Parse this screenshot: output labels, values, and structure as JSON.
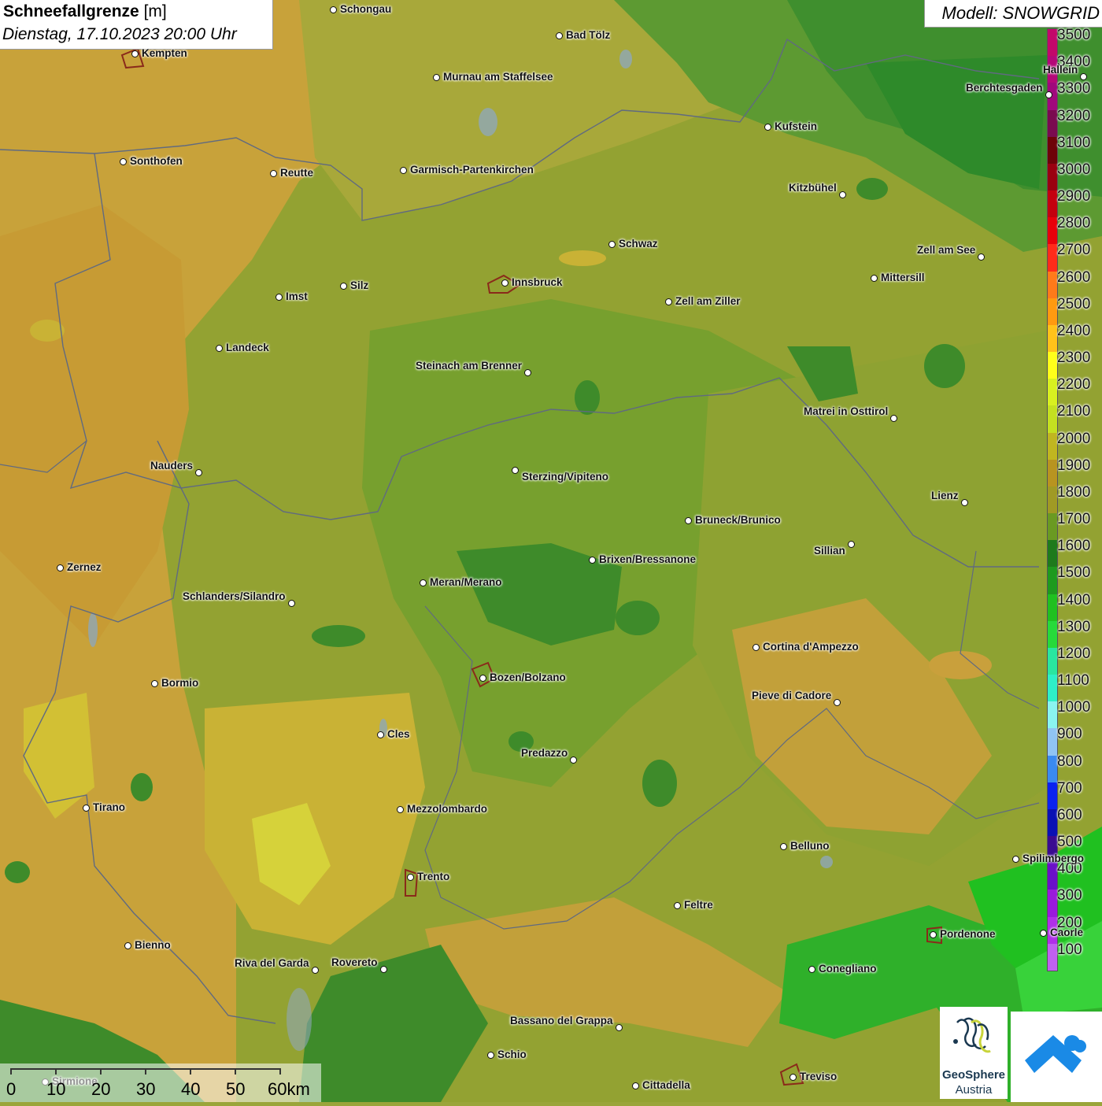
{
  "title": {
    "name": "Schneefallgrenze",
    "unit": "[m]",
    "datetime": "Dienstag, 17.10.2023 20:00 Uhr"
  },
  "model": "Modell: SNOWGRID",
  "legend": {
    "labels": [
      "3500",
      "3400",
      "3300",
      "3200",
      "3100",
      "3000",
      "2900",
      "2800",
      "2700",
      "2600",
      "2500",
      "2400",
      "2300",
      "2200",
      "2100",
      "2000",
      "1900",
      "1800",
      "1700",
      "1600",
      "1500",
      "1400",
      "1300",
      "1200",
      "1100",
      "1000",
      "900",
      "800",
      "700",
      "600",
      "500",
      "400",
      "300",
      "200",
      "100"
    ],
    "colors": [
      "#c2086a",
      "#b50878",
      "#a0087c",
      "#7a0a50",
      "#6e0208",
      "#9a0010",
      "#c4000e",
      "#e8000a",
      "#ff2a1a",
      "#ff7a1a",
      "#ff9a10",
      "#ffc21a",
      "#ffff1a",
      "#d8f020",
      "#c4e020",
      "#c0b620",
      "#b89420",
      "#a09a24",
      "#6a9a22",
      "#1e7a1c",
      "#1e9a1e",
      "#20c020",
      "#26da3a",
      "#2ae6a0",
      "#2ef0c8",
      "#8af4f0",
      "#90c4f4",
      "#3a8af0",
      "#0a22f0",
      "#0a10b4",
      "#3a0a90",
      "#6a10c8",
      "#9a1adc",
      "#b030e8",
      "#c060f0"
    ]
  },
  "cities": [
    "Schongau",
    "Bad Tölz",
    "Kempten",
    "Murnau am Staffelsee",
    "Kufstein",
    "Sonthofen",
    "Reutte",
    "Garmisch-Partenkirchen",
    "Kitzbühel",
    "Schwaz",
    "Zell am See",
    "Innsbruck",
    "Mittersill",
    "Imst",
    "Silz",
    "Zell am Ziller",
    "Landeck",
    "Steinach am Brenner",
    "Matrei in Osttirol",
    "Nauders",
    "Sterzing/Vipiteno",
    "Lienz",
    "Bruneck/Brunico",
    "Sillian",
    "Brixen/Bressanone",
    "Zernez",
    "Meran/Merano",
    "Schlanders/Silandro",
    "Cortina d'Ampezzo",
    "Bormio",
    "Bozen/Bolzano",
    "Pieve di Cadore",
    "Cles",
    "Predazzo",
    "Tirano",
    "Mezzolombardo",
    "Belluno",
    "Spilimbergo",
    "Trento",
    "Feltre",
    "Pordenone",
    "Bienno",
    "Riva del Garda",
    "Rovereto",
    "Conegliano",
    "Bassano del Grappa",
    "Schio",
    "Treviso",
    "Cittadella",
    "Berchtesgaden",
    "Hallein",
    "Caorle",
    "Sirmione"
  ],
  "scale": {
    "labels": [
      "0",
      "10",
      "20",
      "30",
      "40",
      "50",
      "60km"
    ]
  },
  "logos": {
    "geosphere_line1": "GeoSphere",
    "geosphere_line2": "Austria"
  }
}
